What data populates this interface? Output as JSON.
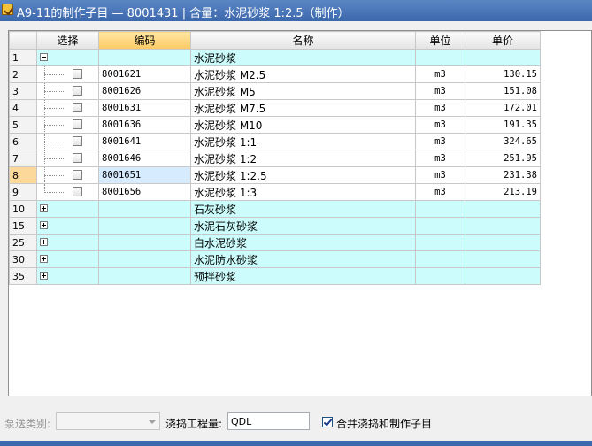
{
  "window": {
    "title": "A9-11的制作子目 — 8001431 | 含量：水泥砂浆 1:2.5（制作）"
  },
  "grid": {
    "headers": {
      "select": "选择",
      "code": "编码",
      "name": "名称",
      "unit": "单位",
      "price": "单价"
    },
    "rows": [
      {
        "num": "1",
        "type": "group",
        "expanded": true,
        "code": "",
        "name": "水泥砂浆",
        "unit": "",
        "price": ""
      },
      {
        "num": "2",
        "type": "item",
        "code": "8001621",
        "name": "水泥砂浆 M2.5",
        "unit": "m3",
        "price": "130.15"
      },
      {
        "num": "3",
        "type": "item",
        "code": "8001626",
        "name": "水泥砂浆 M5",
        "unit": "m3",
        "price": "151.08"
      },
      {
        "num": "4",
        "type": "item",
        "code": "8001631",
        "name": "水泥砂浆 M7.5",
        "unit": "m3",
        "price": "172.01"
      },
      {
        "num": "5",
        "type": "item",
        "code": "8001636",
        "name": "水泥砂浆 M10",
        "unit": "m3",
        "price": "191.35"
      },
      {
        "num": "6",
        "type": "item",
        "code": "8001641",
        "name": "水泥砂浆 1:1",
        "unit": "m3",
        "price": "324.65"
      },
      {
        "num": "7",
        "type": "item",
        "code": "8001646",
        "name": "水泥砂浆 1:2",
        "unit": "m3",
        "price": "251.95"
      },
      {
        "num": "8",
        "type": "item",
        "selected": true,
        "code": "8001651",
        "name": "水泥砂浆 1:2.5",
        "unit": "m3",
        "price": "231.38"
      },
      {
        "num": "9",
        "type": "item",
        "last": true,
        "code": "8001656",
        "name": "水泥砂浆 1:3",
        "unit": "m3",
        "price": "213.19"
      },
      {
        "num": "10",
        "type": "group",
        "expanded": false,
        "code": "",
        "name": "石灰砂浆",
        "unit": "",
        "price": ""
      },
      {
        "num": "15",
        "type": "group",
        "expanded": false,
        "code": "",
        "name": "水泥石灰砂浆",
        "unit": "",
        "price": ""
      },
      {
        "num": "25",
        "type": "group",
        "expanded": false,
        "code": "",
        "name": "白水泥砂浆",
        "unit": "",
        "price": ""
      },
      {
        "num": "30",
        "type": "group",
        "expanded": false,
        "code": "",
        "name": "水泥防水砂浆",
        "unit": "",
        "price": ""
      },
      {
        "num": "35",
        "type": "group",
        "expanded": false,
        "code": "",
        "name": "预拌砂浆",
        "unit": "",
        "price": ""
      }
    ]
  },
  "footer": {
    "pump_type_label": "泵送类别:",
    "pump_type_value": "",
    "pour_label": "浇捣工程量:",
    "pour_value": "QDL",
    "merge_label": "合并浇捣和制作子目",
    "merge_checked": true
  },
  "colors": {
    "titlebar": "#3c68ad",
    "group_row": "#ccfdfc",
    "code_header": "#fbca63",
    "selected_cell": "#d7ebff"
  },
  "icons": {
    "app": "app-icon",
    "expand": "expand-plus-icon",
    "collapse": "collapse-minus-icon"
  }
}
